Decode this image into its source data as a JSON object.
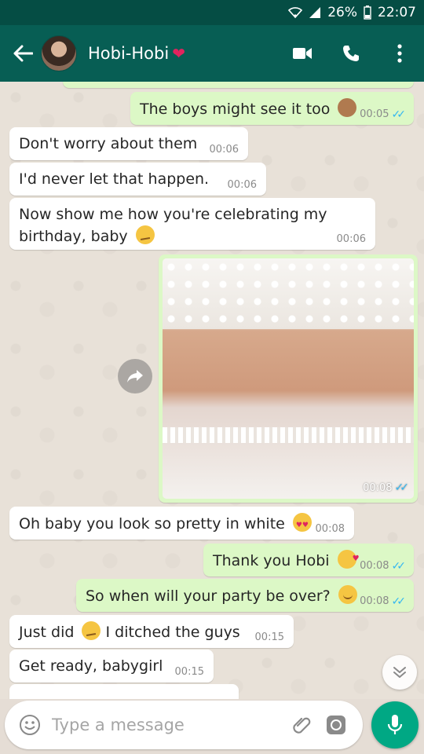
{
  "status_bar": {
    "battery": "26%",
    "time": "22:07"
  },
  "header": {
    "contact_name": "Hobi-Hobi",
    "name_emoji": "❤",
    "icons": [
      "back-arrow-icon",
      "video-call-icon",
      "voice-call-icon",
      "more-options-icon"
    ]
  },
  "messages": [
    {
      "dir": "out",
      "text": "The boys might see it too",
      "emoji": "see-no-evil-monkey",
      "time": "00:05",
      "read": true
    },
    {
      "dir": "in",
      "text": "Don't worry about them",
      "time": "00:06"
    },
    {
      "dir": "in",
      "text": "I'd never let that happen.",
      "time": "00:06"
    },
    {
      "dir": "in",
      "text": "Now show me how you're celebrating my",
      "text2": "birthday, baby",
      "emoji": "smirk",
      "time": "00:06"
    },
    {
      "dir": "out",
      "type": "photo",
      "time": "00:08",
      "read": true
    },
    {
      "dir": "in",
      "text": "Oh baby you look so pretty in white",
      "emoji": "heart-eyes",
      "time": "00:08"
    },
    {
      "dir": "out",
      "text": "Thank you Hobi",
      "emoji": "kiss",
      "time": "00:08",
      "read": true
    },
    {
      "dir": "out",
      "text": "So when will your party be over?",
      "emoji": "blush",
      "time": "00:08",
      "read": true
    },
    {
      "dir": "in",
      "text": "Just did",
      "emoji": "smirk",
      "text2": "I ditched the guys",
      "time": "00:15"
    },
    {
      "dir": "in",
      "text": "Get ready, babygirl",
      "time": "00:15"
    }
  ],
  "input": {
    "placeholder": "Type a message"
  },
  "colors": {
    "header": "#075e54",
    "status_bar": "#054d44",
    "outgoing": "#dcf8c6",
    "incoming": "#ffffff",
    "accent": "#00a884",
    "read_ticks": "#34b7f1"
  }
}
